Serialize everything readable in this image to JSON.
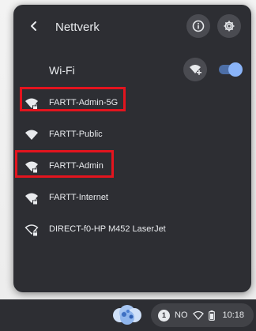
{
  "header": {
    "title": "Nettverk",
    "back_icon": "arrow-left-icon",
    "info_icon": "info-icon",
    "settings_icon": "gear-icon"
  },
  "wifi": {
    "label": "Wi-Fi",
    "add_icon": "wifi-add-icon",
    "toggle_on": true
  },
  "networks": [
    {
      "name": "FARTT-Admin-5G",
      "icon": "wifi-lock-icon",
      "highlighted": true
    },
    {
      "name": "FARTT-Public",
      "icon": "wifi-icon",
      "highlighted": false
    },
    {
      "name": "FARTT-Admin",
      "icon": "wifi-lock-icon",
      "highlighted": true
    },
    {
      "name": "FARTT-Internet",
      "icon": "wifi-lock-icon",
      "highlighted": false
    },
    {
      "name": "DIRECT-f0-HP M452 LaserJet",
      "icon": "wifi-lock-outline-icon",
      "highlighted": false
    }
  ],
  "shelf": {
    "notification_count": "1",
    "keyboard_layout": "NO",
    "time": "10:18",
    "wifi_icon": "wifi-status-icon",
    "battery_icon": "battery-icon",
    "launcher_icon": "launcher-icon"
  },
  "colors": {
    "panel_bg": "#2d2e33",
    "button_bg": "#4a4b51",
    "accent": "#8ab4f8",
    "highlight": "#e3141e"
  }
}
